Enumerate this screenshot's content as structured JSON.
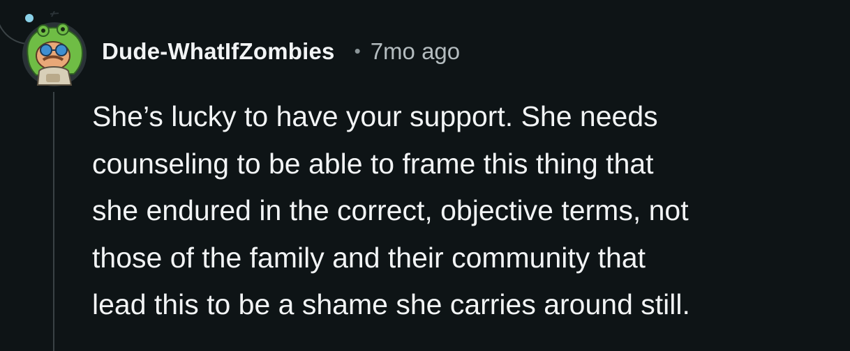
{
  "comment": {
    "author": "Dude-WhatIfZombies",
    "separator": "•",
    "timestamp": "7mo ago",
    "avatar_icon": "frog-hat-avatar-icon",
    "body_lines": [
      "She’s lucky to have your support. She needs",
      "counseling to be able to frame this thing that",
      "she endured in the correct, objective terms, not",
      "those of the family and their community that",
      "lead this to be a shame she carries around still."
    ]
  },
  "colors": {
    "background": "#0e1416",
    "text": "#f2f4f5",
    "meta": "#b4bcbf",
    "thread_line": "#3a4245",
    "avatar_bg": "#2a3236",
    "frog_green": "#6fbd45"
  }
}
